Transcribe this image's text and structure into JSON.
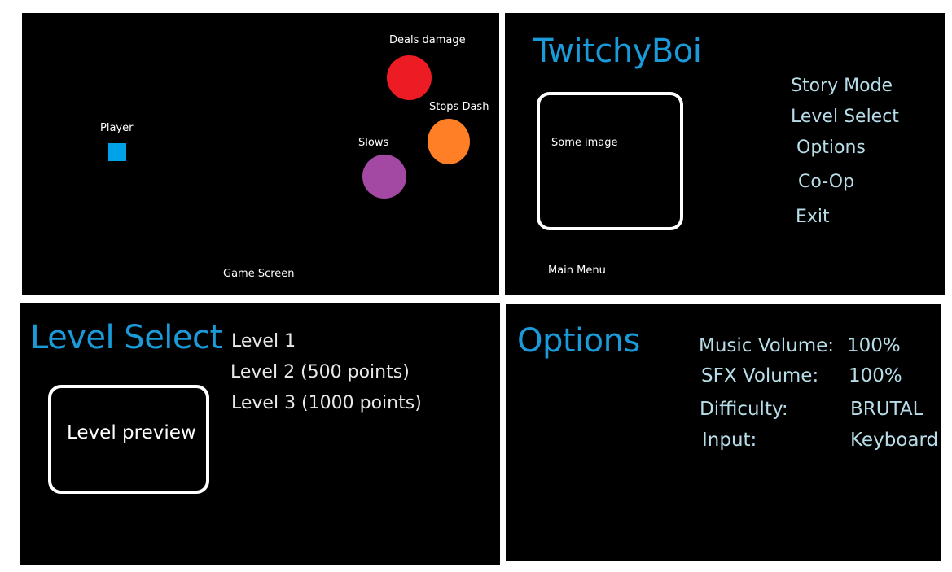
{
  "game_screen": {
    "caption": "Game Screen",
    "player_label": "Player",
    "hazards": [
      {
        "label": "Deals damage",
        "color": "#ed1c24"
      },
      {
        "label": "Stops Dash",
        "color": "#ff7f27"
      },
      {
        "label": "Slows",
        "color": "#a349a4"
      }
    ],
    "player_color": "#00a2e8"
  },
  "main_menu": {
    "title": "TwitchyBoi",
    "image_placeholder": "Some image",
    "items": [
      "Story Mode",
      "Level Select",
      "Options",
      "Co-Op",
      "Exit"
    ],
    "caption": "Main Menu"
  },
  "level_select": {
    "title": "Level Select",
    "preview_label": "Level preview",
    "levels": [
      "Level 1",
      "Level 2 (500 points)",
      "Level 3 (1000 points)"
    ]
  },
  "options": {
    "title": "Options",
    "settings": [
      {
        "label": "Music Volume:",
        "value": "100%"
      },
      {
        "label": "SFX Volume:",
        "value": "100%"
      },
      {
        "label": "Difficulty:",
        "value": "BRUTAL"
      },
      {
        "label": "Input:",
        "value": "Keyboard"
      }
    ]
  },
  "colors": {
    "title_blue": "#1a9ad9",
    "menu_text": "#b7dde8"
  }
}
